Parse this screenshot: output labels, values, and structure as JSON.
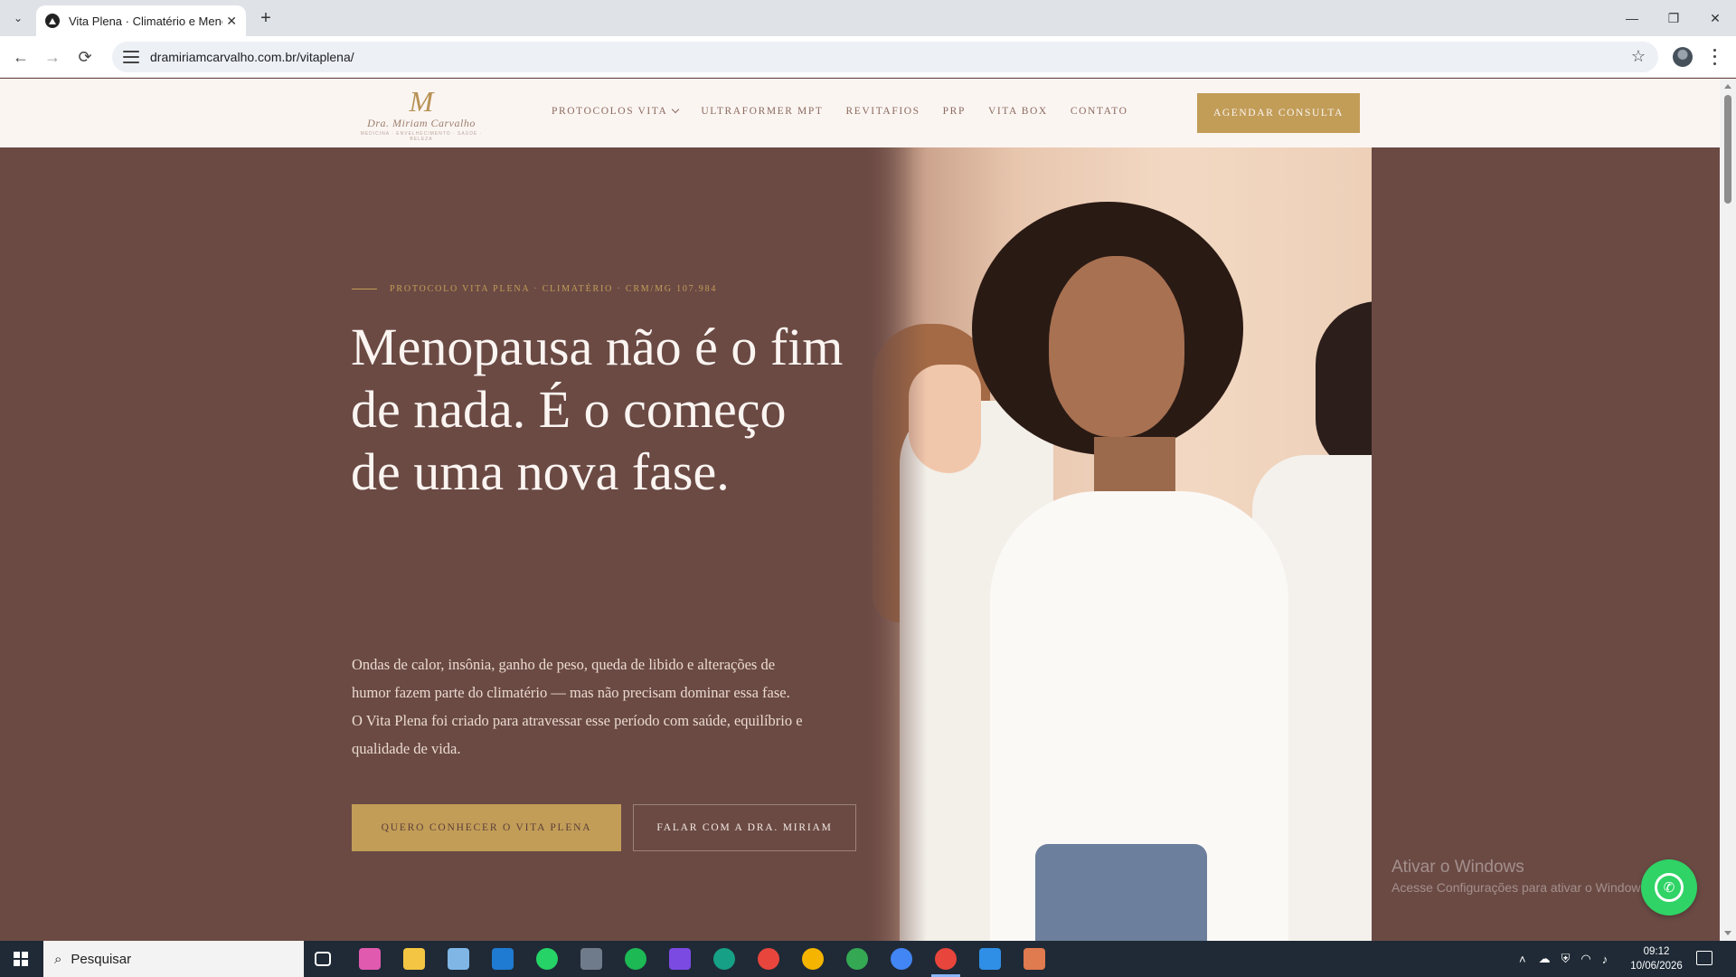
{
  "browser": {
    "tab_title": "Vita Plena · Climatério e Menop",
    "tab_close": "✕",
    "new_tab": "+",
    "url": "dramiriamcarvalho.com.br/vitaplena/",
    "back": "←",
    "forward": "→",
    "reload": "⟳",
    "star": "☆",
    "minimize": "—",
    "restore": "❐",
    "close": "✕",
    "tab_menu": "⌄"
  },
  "header": {
    "logo_mark": "M",
    "logo_name": "Dra. Miriam Carvalho",
    "logo_tag": "MEDICINA · ENVELHECIMENTO · SAÚDE · BELEZA",
    "nav": [
      {
        "label": "PROTOCOLOS VITA"
      },
      {
        "label": "ULTRAFORMER MPT"
      },
      {
        "label": "REVITAFIOS"
      },
      {
        "label": "PRP"
      },
      {
        "label": "VITA BOX"
      },
      {
        "label": "CONTATO"
      }
    ],
    "cta": "AGENDAR CONSULTA"
  },
  "hero": {
    "eyebrow": "PROTOCOLO VITA PLENA · CLIMATÉRIO · CRM/MG 107.984",
    "headline_lines": [
      "Menopausa não é o fim",
      "de nada. É o começo",
      "de uma nova fase."
    ],
    "lead": "Ondas de calor, insônia, ganho de peso, queda de libido e alterações de humor fazem parte do climatério — mas não precisam dominar essa fase. O Vita Plena foi criado para atravessar esse período com saúde, equilíbrio e qualidade de vida.",
    "primary_button": "QUERO CONHECER O VITA PLENA",
    "secondary_button": "FALAR COM A DRA. MIRIAM"
  },
  "overlay": {
    "activation_title": "Ativar o Windows",
    "activation_text": "Acesse Configurações para ativar o Windows.",
    "whatsapp_icon": "whatsapp-icon"
  },
  "taskbar": {
    "search_placeholder": "Pesquisar",
    "time": "09:12",
    "date": "10/06/2026",
    "apps": [
      {
        "name": "task-view",
        "color": "#ffffff"
      },
      {
        "name": "copilot",
        "color": "#e05ab0"
      },
      {
        "name": "file-explorer",
        "color": "#f4c542"
      },
      {
        "name": "notepad",
        "color": "#7fb6e6"
      },
      {
        "name": "outlook",
        "color": "#1f7ad1"
      },
      {
        "name": "whatsapp",
        "color": "#25d366"
      },
      {
        "name": "calculator",
        "color": "#6f7b8a"
      },
      {
        "name": "spotify",
        "color": "#1db954"
      },
      {
        "name": "clipchamp",
        "color": "#7b4ae2"
      },
      {
        "name": "edge",
        "color": "#16a085"
      },
      {
        "name": "chrome-1",
        "color": "#e8453c"
      },
      {
        "name": "chrome-2",
        "color": "#f5b400"
      },
      {
        "name": "chrome-3",
        "color": "#34a853"
      },
      {
        "name": "chrome-4",
        "color": "#4285f4"
      },
      {
        "name": "chrome-5",
        "color": "#e8453c"
      },
      {
        "name": "vscode",
        "color": "#2f8ee5"
      },
      {
        "name": "claude",
        "color": "#e07a4f"
      }
    ]
  },
  "colors": {
    "hero_bg": "#6b4a44",
    "gold": "#c29d58",
    "header_bg": "#fbf5f2"
  }
}
